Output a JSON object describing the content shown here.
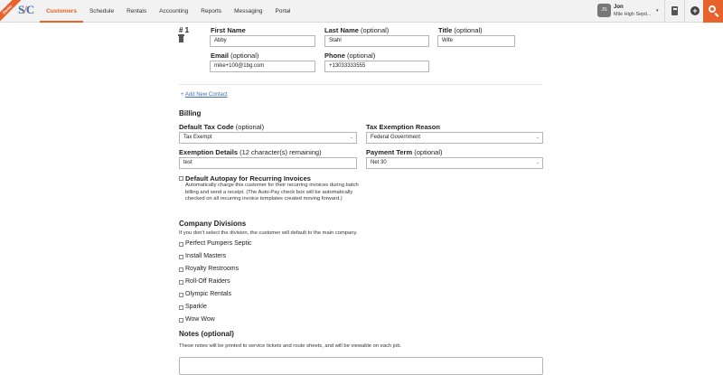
{
  "nav": {
    "logo_ribbon": "Demo",
    "logo_mark_a": "S",
    "logo_mark_b": "C",
    "items": [
      {
        "label": "Customers",
        "active": true
      },
      {
        "label": "Schedule"
      },
      {
        "label": "Rentals"
      },
      {
        "label": "Accounting"
      },
      {
        "label": "Reports"
      },
      {
        "label": "Messaging"
      },
      {
        "label": "Portal"
      }
    ],
    "user": {
      "initials": "JS",
      "name": "Jon",
      "company": "Mile High Septi..."
    }
  },
  "contact": {
    "number": "# 1",
    "first_name": {
      "label": "First Name",
      "value": "Abby"
    },
    "last_name": {
      "label": "Last Name",
      "optional": "(optional)",
      "value": "Stahl"
    },
    "title": {
      "label": "Title",
      "optional": "(optional)",
      "value": "Wife"
    },
    "email": {
      "label": "Email",
      "optional": "(optional)",
      "value": "mike+100@1bg.com"
    },
    "phone": {
      "label": "Phone",
      "optional": "(optional)",
      "value": "+13033333555"
    },
    "add_link": "Add New Contact"
  },
  "billing": {
    "heading": "Billing",
    "tax_code": {
      "label": "Default Tax Code",
      "optional": "(optional)",
      "value": "Tax Exempt"
    },
    "tax_exemption": {
      "label": "Tax Exemption Reason",
      "value": "Federal Government"
    },
    "exemption_details": {
      "label": "Exemption Details",
      "remaining": "(12 character(s) remaining)",
      "value": "test"
    },
    "payment_term": {
      "label": "Payment Term",
      "optional": "(optional)",
      "value": "Net 30"
    },
    "autopay": {
      "label": "Default Autopay for Recurring Invoices",
      "description": "Automatically charge this customer for their recurring invoices during batch billing and send a receipt. (The Auto-Pay check box will be automatically checked on all recurring invoice templates created moving forward.)"
    }
  },
  "divisions": {
    "heading": "Company Divisions",
    "note": "If you don't select the division, the customer will default to the main company.",
    "items": [
      "Perfect Pumpers Septic",
      "Install Masters",
      "Royalty Restrooms",
      "Roll-Off Raiders",
      "Olympic Rentals",
      "Sparkle",
      "Wow Wow"
    ]
  },
  "notes": {
    "heading": "Notes (optional)",
    "note": "These notes will be printed to service tickets and route sheets, and will be viewable on each job."
  },
  "colors": {
    "accent": "#e8622b",
    "link": "#3e6fb4"
  },
  "icons": [
    "trash-icon",
    "plus-icon",
    "calculator-icon",
    "add-circle-icon",
    "search-icon",
    "caret-down-icon"
  ]
}
